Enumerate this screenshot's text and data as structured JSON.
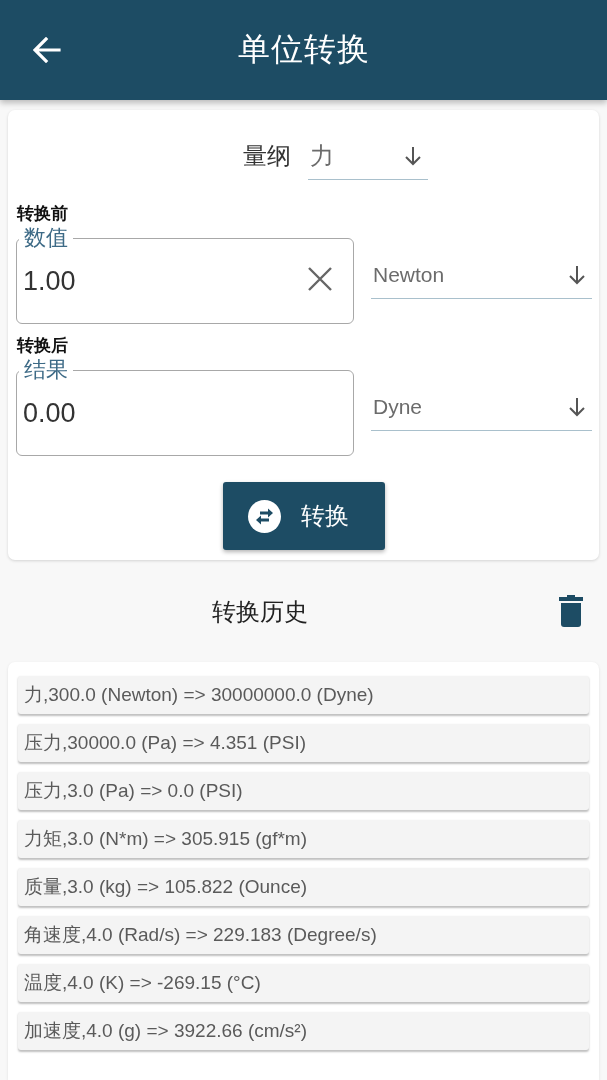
{
  "app_bar": {
    "title": "单位转换"
  },
  "dimension": {
    "label": "量纲",
    "value": "力"
  },
  "source": {
    "section_label": "转换前",
    "field_label": "数值",
    "value": "1.00",
    "clearable": true,
    "unit": "Newton"
  },
  "target": {
    "section_label": "转换后",
    "field_label": "结果",
    "value": "0.00",
    "clearable": false,
    "unit": "Dyne"
  },
  "convert_button": {
    "label": "转换"
  },
  "history": {
    "title": "转换历史",
    "items": [
      "力,300.0 (Newton) => 30000000.0 (Dyne)",
      "压力,30000.0 (Pa) => 4.351 (PSI)",
      "压力,3.0 (Pa) => 0.0 (PSI)",
      "力矩,3.0 (N*m) => 305.915 (gf*m)",
      "质量,3.0 (kg) => 105.822 (Ounce)",
      "角速度,4.0 (Rad/s) => 229.183 (Degree/s)",
      "温度,4.0 (K) => -269.15 (°C)",
      "加速度,4.0 (g) => 3922.66 (cm/s²)"
    ]
  }
}
